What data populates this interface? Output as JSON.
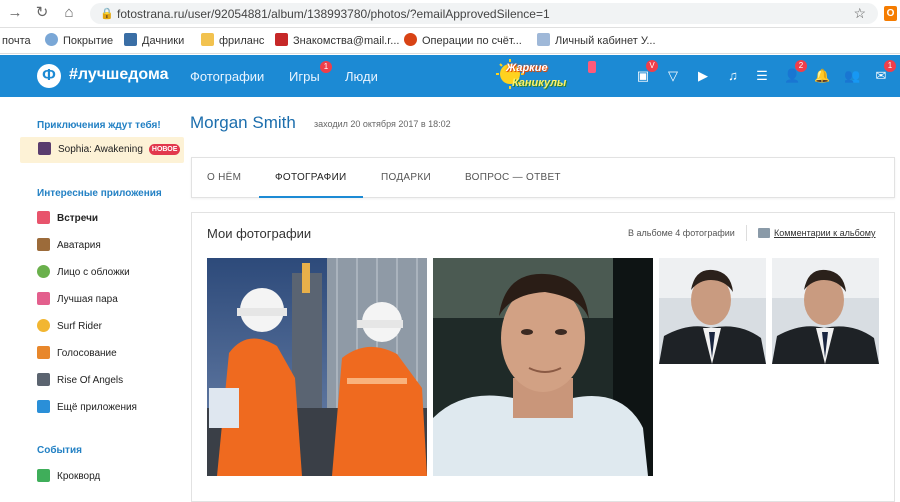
{
  "browser": {
    "url": "fotostrana.ru/user/92054881/album/138993780/photos/?emailApprovedSilence=1",
    "extension_badge": "ok"
  },
  "bookmarks": [
    {
      "label": "почта",
      "icon": "none"
    },
    {
      "label": "Покрытие",
      "icon": "network-icon"
    },
    {
      "label": "Дачники",
      "icon": "triangle-icon"
    },
    {
      "label": "фриланс",
      "icon": "folder-icon"
    },
    {
      "label": "Знакомства@mail.r...",
      "icon": "x-icon"
    },
    {
      "label": "Операции по счёт...",
      "icon": "bank-icon"
    },
    {
      "label": "Личный кабинет У...",
      "icon": "shield-icon"
    }
  ],
  "topbar": {
    "logo_letter": "Ф",
    "logo_text": "#лучшедома",
    "nav": [
      {
        "label": "Фотографии"
      },
      {
        "label": "Игры",
        "badge": "1"
      },
      {
        "label": "Люди"
      }
    ],
    "promo_line1": "Жаркие",
    "promo_line2": "Каникулы",
    "icons": [
      {
        "name": "gift-icon",
        "badge": "V"
      },
      {
        "name": "diamond-icon"
      },
      {
        "name": "video-icon"
      },
      {
        "name": "music-icon"
      },
      {
        "name": "list-icon"
      },
      {
        "name": "friends-icon",
        "badge": "2"
      },
      {
        "name": "bell-icon"
      },
      {
        "name": "people-icon"
      },
      {
        "name": "mail-icon",
        "badge": "1"
      }
    ],
    "color": "#1c8ad4"
  },
  "sidebar": {
    "adventure_heading": "Приключения ждут тебя!",
    "featured": {
      "label": "Sophia: Awakening",
      "badge": "НОВОЕ"
    },
    "apps_heading": "Интересные приложения",
    "apps": [
      {
        "label": "Встречи",
        "bold": true,
        "color": "#e8546c"
      },
      {
        "label": "Аватария",
        "color": "#9c6b3a"
      },
      {
        "label": "Лицо с обложки",
        "color": "#6ab04c"
      },
      {
        "label": "Лучшая пара",
        "color": "#e35f8d"
      },
      {
        "label": "Surf Rider",
        "color": "#f2b632"
      },
      {
        "label": "Голосование",
        "color": "#e8872b"
      },
      {
        "label": "Rise Of Angels",
        "color": "#5b6470"
      },
      {
        "label": "Ещё приложения",
        "color": "#2a8fd8"
      }
    ],
    "events_heading": "События",
    "events": [
      {
        "label": "Кроквордe",
        "color": "#3fae5a"
      }
    ]
  },
  "profile": {
    "name": "Morgan Smith",
    "last_seen": "заходил 20 октября 2017 в 18:02"
  },
  "tabs": [
    {
      "label": "О НЁМ",
      "active": false
    },
    {
      "label": "ФОТОГРАФИИ",
      "active": true
    },
    {
      "label": "ПОДАРКИ",
      "active": false
    },
    {
      "label": "ВОПРОС — ОТВЕТ",
      "active": false
    }
  ],
  "album": {
    "title": "Мои фотографии",
    "count_text": "В альбоме 4 фотографии",
    "comments_link": "Комментарии к альбому"
  }
}
